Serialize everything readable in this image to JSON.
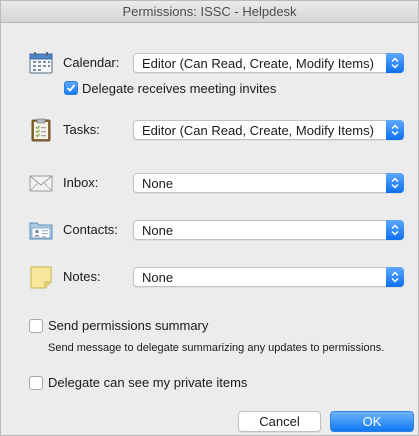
{
  "window": {
    "title": "Permissions: ISSC - Helpdesk"
  },
  "calendar": {
    "label": "Calendar:",
    "icon": "calendar-icon",
    "value": "Editor (Can Read, Create, Modify Items)",
    "meeting_invites_label": "Delegate receives meeting invites",
    "meeting_invites_checked": true
  },
  "tasks": {
    "label": "Tasks:",
    "icon": "clipboard-icon",
    "value": "Editor (Can Read, Create, Modify Items)"
  },
  "inbox": {
    "label": "Inbox:",
    "icon": "envelope-icon",
    "value": "None"
  },
  "contacts": {
    "label": "Contacts:",
    "icon": "contact-card-icon",
    "value": "None"
  },
  "notes": {
    "label": "Notes:",
    "icon": "note-icon",
    "value": "None"
  },
  "summary": {
    "label": "Send permissions summary",
    "help": "Send message to delegate summarizing any updates to permissions.",
    "checked": false
  },
  "private": {
    "label": "Delegate can see my private items",
    "checked": false
  },
  "buttons": {
    "cancel": "Cancel",
    "ok": "OK"
  },
  "colors": {
    "accent": "#137cf5",
    "background": "#ececec"
  }
}
